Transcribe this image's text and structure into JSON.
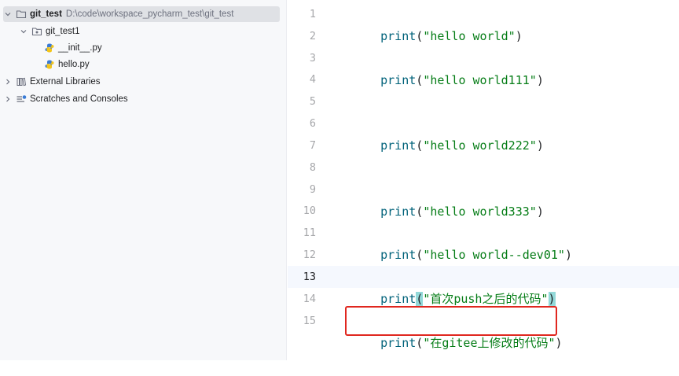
{
  "project_tree": {
    "root": {
      "name": "git_test",
      "path": "D:\\code\\workspace_pycharm_test\\git_test"
    },
    "folder": {
      "name": "git_test1"
    },
    "files": [
      {
        "name": "__init__.py"
      },
      {
        "name": "hello.py"
      }
    ],
    "external_libraries": {
      "label": "External Libraries"
    },
    "scratches": {
      "label": "Scratches and Consoles"
    }
  },
  "editor": {
    "line_numbers": [
      "1",
      "2",
      "3",
      "4",
      "5",
      "6",
      "7",
      "8",
      "9",
      "10",
      "11",
      "12",
      "13",
      "14",
      "15"
    ],
    "current_line": "13",
    "code_lines": [
      {
        "line": "1",
        "fn": "print",
        "open": "(",
        "str": "\"hello world\"",
        "close": ")"
      },
      {
        "line": "3",
        "fn": "print",
        "open": "(",
        "str": "\"hello world111\"",
        "close": ")"
      },
      {
        "line": "6",
        "fn": "print",
        "open": "(",
        "str": "\"hello world222\"",
        "close": ")"
      },
      {
        "line": "9",
        "fn": "print",
        "open": "(",
        "str": "\"hello world333\"",
        "close": ")"
      },
      {
        "line": "11",
        "fn": "print",
        "open": "(",
        "str": "\"hello world--dev01\"",
        "close": ")"
      },
      {
        "line": "13",
        "fn": "print",
        "open": "(",
        "str": "\"首次push之后的代码\"",
        "close": ")"
      },
      {
        "line": "15",
        "fn": "print",
        "open": "(",
        "str": "\"在gitee上修改的代码\"",
        "close": ")"
      }
    ]
  },
  "icons": {
    "root_chevron": "chevron-down-icon",
    "folder_chevron": "chevron-down-icon",
    "collapsed_chevron": "chevron-right-icon",
    "root_icon": "folder-icon",
    "package_icon": "package-folder-icon",
    "python_file_icon": "python-file-icon",
    "libraries_icon": "library-icon",
    "scratches_icon": "scratches-icon"
  },
  "colors": {
    "annotation_border": "#e0271f",
    "bracket_match": "#93d9d9",
    "keyword_function": "#00627a",
    "string": "#067d17"
  }
}
